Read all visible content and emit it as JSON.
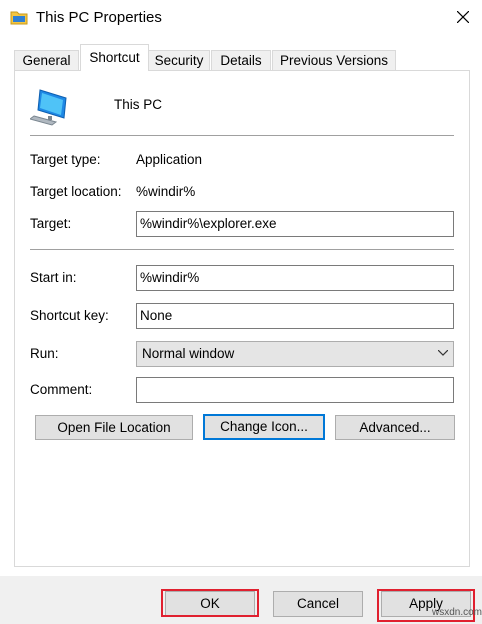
{
  "window": {
    "title": "This PC Properties"
  },
  "tabs": [
    {
      "label": "General"
    },
    {
      "label": "Shortcut"
    },
    {
      "label": "Security"
    },
    {
      "label": "Details"
    },
    {
      "label": "Previous Versions"
    }
  ],
  "active_tab": "Shortcut",
  "shortcut": {
    "name": "This PC",
    "target_type_label": "Target type:",
    "target_type_value": "Application",
    "target_location_label": "Target location:",
    "target_location_value": "%windir%",
    "target_label": "Target:",
    "target_value": "%windir%\\explorer.exe",
    "start_in_label": "Start in:",
    "start_in_value": "%windir%",
    "shortcut_key_label": "Shortcut key:",
    "shortcut_key_value": "None",
    "run_label": "Run:",
    "run_value": "Normal window",
    "comment_label": "Comment:",
    "comment_value": ""
  },
  "buttons": {
    "open_file_location": "Open File Location",
    "change_icon": "Change Icon...",
    "advanced": "Advanced...",
    "ok": "OK",
    "cancel": "Cancel",
    "apply": "Apply"
  },
  "icons": {
    "title": "folder-icon",
    "shortcut": "computer-icon",
    "close": "close-icon",
    "dropdown": "chevron-down-icon"
  },
  "highlight_color": "#e0202f",
  "focus_color": "#0078d7",
  "watermark": "wsxdn.com"
}
